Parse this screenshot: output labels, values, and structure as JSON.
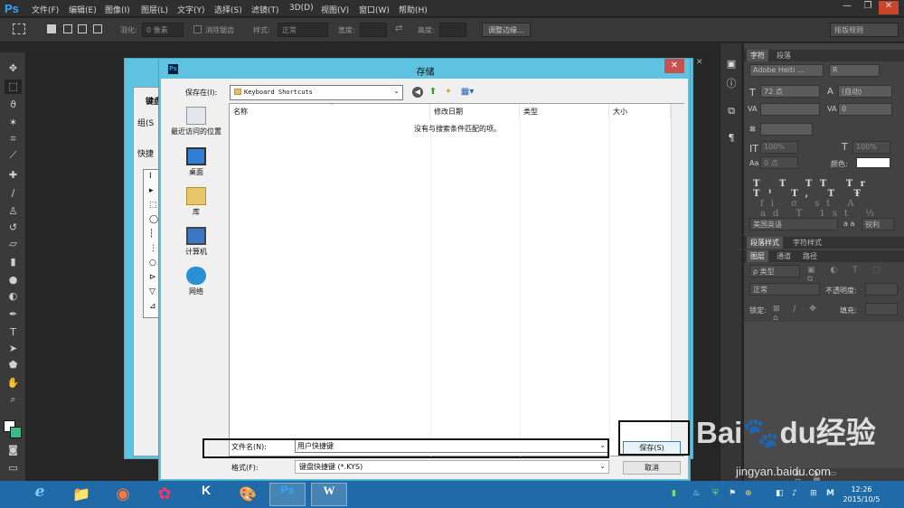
{
  "app": {
    "logo": "Ps"
  },
  "menu": [
    "文件(F)",
    "编辑(E)",
    "图像(I)",
    "图层(L)",
    "文字(Y)",
    "选择(S)",
    "滤镜(T)",
    "3D(D)",
    "视图(V)",
    "窗口(W)",
    "帮助(H)"
  ],
  "window_controls": {
    "minimize": "—",
    "restore": "❐",
    "close": "✕"
  },
  "options": {
    "feather_label": "羽化:",
    "feather_value": "0 像素",
    "antialias": "消除锯齿",
    "style_label": "样式:",
    "style_value": "正常",
    "width_label": "宽度:",
    "height_label": "高度:",
    "refine_btn": "调整边缘...",
    "workspace": "排版规则"
  },
  "tools": [
    "marquee",
    "move",
    "lasso",
    "magic-wand",
    "crop",
    "eyedropper",
    "healing",
    "brush",
    "stamp",
    "history-brush",
    "eraser",
    "gradient",
    "blur",
    "dodge",
    "pen",
    "type",
    "path-select",
    "shape",
    "hand",
    "zoom"
  ],
  "bg_dialog": {
    "label1": "键盘",
    "label2": "组(S",
    "label3": "快捷",
    "rows": [
      "I",
      "▸",
      "⬚",
      "◯",
      "┆",
      "⋮",
      "○",
      "⊳",
      "▽",
      "⊿"
    ]
  },
  "save_dialog": {
    "title": "存储",
    "save_in_label": "保存在(I):",
    "save_in_value": "Keyboard Shortcuts",
    "places": [
      {
        "label": "最近访问的位置"
      },
      {
        "label": "桌面"
      },
      {
        "label": "库"
      },
      {
        "label": "计算机"
      },
      {
        "label": "网络"
      }
    ],
    "columns": [
      "名称",
      "修改日期",
      "类型",
      "大小"
    ],
    "empty_message": "没有与搜索条件匹配的项。",
    "filename_label": "文件名(N):",
    "filename_value": "用户快捷键",
    "format_label": "格式(F):",
    "format_value": "键盘快捷键 (*.KYS)",
    "save_button": "保存(S)",
    "cancel_button": "取消"
  },
  "panels": {
    "tabs_top": [
      "字符",
      "段落"
    ],
    "font_family": "Adobe Heiti ...",
    "font_style": "R",
    "font_size": "72 点",
    "leading": "(自动)",
    "tracking": "0",
    "scale_v": "100%",
    "scale_h": "100%",
    "baseline": "0 点",
    "color_label": "颜色:",
    "language": "美国英语",
    "antialias": "锐利",
    "aa_label": "a a",
    "tabs_mid": [
      "段落样式",
      "字符样式"
    ],
    "tabs_layers": [
      "图层",
      "通道",
      "路径"
    ],
    "kind_filter": "ρ 类型",
    "blend_mode": "正常",
    "opacity_label": "不透明度:",
    "lock_label": "锁定:",
    "fill_label": "填充:",
    "type_glyphs": [
      "T",
      "T",
      "TT",
      "Tr",
      "T¹",
      "T,",
      "T",
      "Ŧ"
    ],
    "ot_glyphs": [
      "fi",
      "σ",
      "st",
      "A",
      "ad",
      "T",
      "1st",
      "½"
    ]
  },
  "taskbar": {
    "apps": [
      "e",
      "📁",
      "◉",
      "✿",
      "K",
      "🎨",
      "Ps",
      "W"
    ],
    "tray": [
      "▮",
      "♨",
      "⛨",
      "⚑",
      "⊕",
      "◧",
      "♪",
      "⊞",
      "M"
    ],
    "time": "12:26",
    "date": "2015/10/5"
  },
  "watermark": {
    "brand": "Bai🐾du经验",
    "url": "jingyan.baidu.com"
  }
}
